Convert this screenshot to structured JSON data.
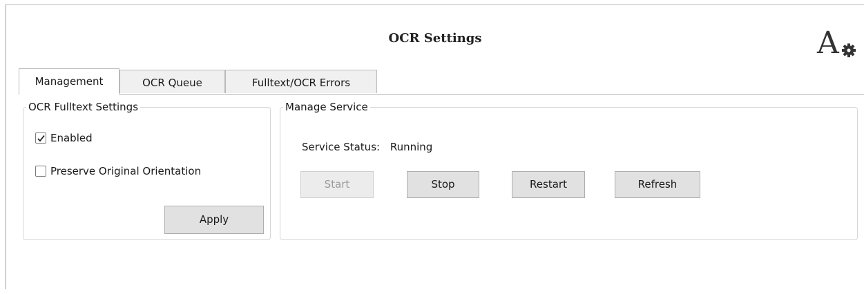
{
  "window": {
    "title": "OCR Settings",
    "logo_icon": "font-settings-icon"
  },
  "tabs": [
    {
      "label": "Management",
      "active": true
    },
    {
      "label": "OCR Queue",
      "active": false
    },
    {
      "label": "Fulltext/OCR Errors",
      "active": false
    }
  ],
  "ocr_fulltext": {
    "group_title": "OCR Fulltext Settings",
    "enabled_label": "Enabled",
    "enabled_checked": true,
    "preserve_label": "Preserve Original Orientation",
    "preserve_checked": false,
    "apply_label": "Apply"
  },
  "manage_service": {
    "group_title": "Manage Service",
    "status_label": "Service Status:",
    "status_value": "Running",
    "buttons": {
      "start": "Start",
      "stop": "Stop",
      "restart": "Restart",
      "refresh": "Refresh"
    },
    "start_disabled": true
  }
}
